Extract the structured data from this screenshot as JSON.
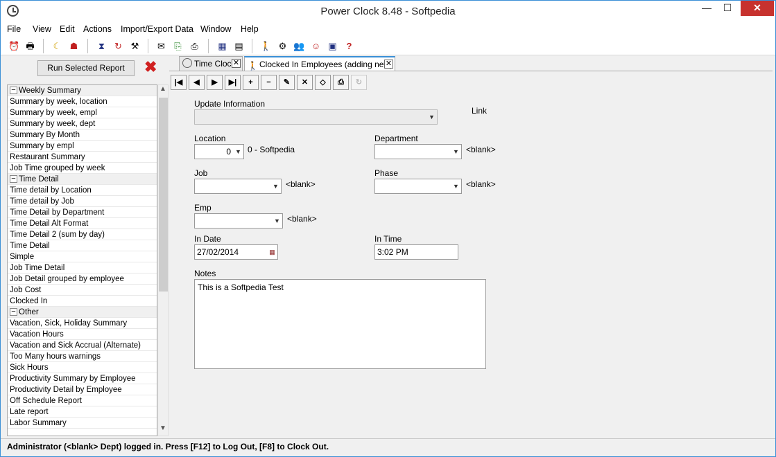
{
  "window": {
    "title": "Power Clock 8.48 - Softpedia",
    "minimize": "—",
    "maximize": "☐",
    "close": "✕"
  },
  "menu": [
    "File",
    "View",
    "Edit",
    "Actions",
    "Import/Export Data",
    "Window",
    "Help"
  ],
  "toolbar_icons": [
    "alarm-clock-icon",
    "printer-icon",
    "moon-icon",
    "user-printer-icon",
    "hourglass-icon",
    "clock-arrow-icon",
    "tools-icon",
    "envelope-icon",
    "export-icon",
    "print-icon",
    "calendar-icon",
    "calculator-icon",
    "walking-person-icon",
    "gears-icon",
    "people-icon",
    "group-icon",
    "id-card-icon",
    "help-icon"
  ],
  "left": {
    "run_button": "Run Selected Report",
    "cancel_glyph": "✖",
    "groups": [
      {
        "name": "Weekly Summary",
        "items": [
          "Summary by week, location",
          "Summary by week, empl",
          "Summary by week, dept",
          "Summary By Month",
          "Summary by empl",
          "Restaurant Summary",
          "Job Time grouped by week"
        ]
      },
      {
        "name": "Time Detail",
        "items": [
          "Time detail by Location",
          "Time detail by Job",
          "Time Detail by Department",
          "Time Detail Alt Format",
          "Time Detail 2 (sum by day)",
          "Time Detail",
          "Simple",
          "Job Time Detail",
          "Job Detail grouped by employee",
          "Job Cost",
          "Clocked In"
        ]
      },
      {
        "name": "Other",
        "items": [
          "Vacation, Sick, Holiday Summary",
          "Vacation Hours",
          "Vacation and Sick Accrual (Alternate)",
          "Too Many hours warnings",
          "Sick Hours",
          "Productivity Summary by Employee",
          "Productivity Detail by Employee",
          "Off Schedule Report",
          "Late report",
          "Labor Summary"
        ]
      }
    ]
  },
  "tabs": [
    {
      "label": "Time Clock",
      "icon": "clock-icon"
    },
    {
      "label": "Clocked In Employees (adding new)",
      "icon": "walking-person-icon"
    }
  ],
  "form": {
    "update_info_label": "Update Information",
    "link_label": "Link",
    "location_label": "Location",
    "location_value": "0",
    "location_desc": "0 - Softpedia",
    "department_label": "Department",
    "department_desc": "<blank>",
    "job_label": "Job",
    "job_desc": "<blank>",
    "phase_label": "Phase",
    "phase_desc": "<blank>",
    "emp_label": "Emp",
    "emp_desc": "<blank>",
    "in_date_label": "In Date",
    "in_date_value": "27/02/2014",
    "in_time_label": "In Time",
    "in_time_value": "3:02 PM",
    "notes_label": "Notes",
    "notes_value": "This is a Softpedia Test"
  },
  "status": "Administrator (<blank> Dept) logged in.  Press [F12] to Log Out, [F8] to Clock Out."
}
